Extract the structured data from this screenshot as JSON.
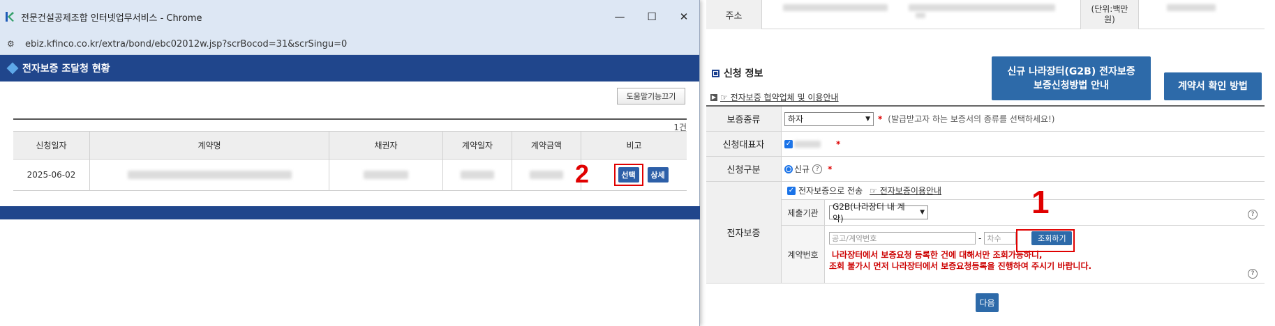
{
  "background": {
    "address_label": "주소",
    "unit_label": "(단위:백만\n원)",
    "section_title": "신청 정보",
    "guide_link": "☞ 전자보증 협약업체 및 이용안내",
    "g2b_button": "신규 나라장터(G2B) 전자보증\n보증신청방법 안내",
    "contract_button": "계약서 확인 방법",
    "rows": {
      "guarantee_type": {
        "label": "보증종류",
        "value": "하자",
        "hint": "(발급받고자 하는 보증서의 종류를 선택하세요!)"
      },
      "applicant": {
        "label": "신청대표자"
      },
      "category": {
        "label": "신청구분",
        "value": "신규"
      },
      "e_guarantee": {
        "label": "전자보증",
        "send_label": "전자보증으로 전송",
        "usage_link": "☞ 전자보증이용안내",
        "agency_label": "제출기관",
        "agency_value": "G2B(나라장터 내 계약)",
        "contract_no_label": "계약번호",
        "contract_placeholder": "공고/계약번호",
        "dash": "-",
        "seq_placeholder": "차수",
        "lookup_button": "조회하기",
        "warning_line1": "나라장터에서 보증요청 등록한 건에 대해서만 조회가능하니,",
        "warning_line2": "조회 불가시 먼저 나라장터에서 보증요청등록을 진행하여 주시기 바랍니다."
      }
    },
    "next_button": "다음",
    "annotation_1": "1",
    "required_mark": "*",
    "help_glyph": "?"
  },
  "popup": {
    "window_title": "전문건설공제조합 인터넷업무서비스 - Chrome",
    "url": "ebiz.kfinco.co.kr/extra/bond/ebc02012w.jsp?scrBocod=31&scrSingu=0",
    "header": "전자보증 조달청 현황",
    "help_toggle_button": "도움말기능끄기",
    "count": "1건",
    "columns": [
      "신청일자",
      "계약명",
      "채권자",
      "계약일자",
      "계약금액",
      "비고"
    ],
    "rows": [
      {
        "date": "2025-06-02",
        "select_label": "선택",
        "detail_label": "상세"
      }
    ],
    "annotation_2": "2"
  }
}
